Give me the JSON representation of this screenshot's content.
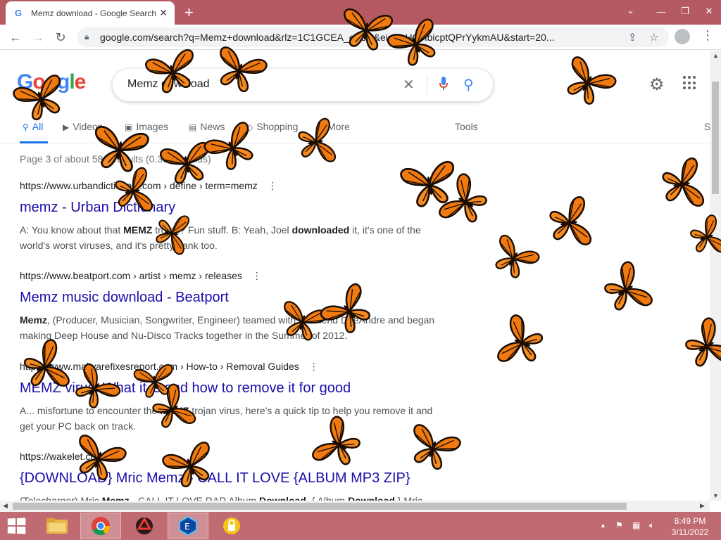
{
  "browser": {
    "tab_title": "Memz download - Google Search",
    "tab_favicon": "G",
    "url": "google.com/search?q=Memz+download&rlz=1C1GCEA_enUS&ei=YuHOHbicptQPrYykmAU&start=20..."
  },
  "search": {
    "logo": "Google",
    "query": "Memz download",
    "tabs": [
      {
        "label": "All",
        "icon": "search-icon"
      },
      {
        "label": "Videos",
        "icon": "video-icon"
      },
      {
        "label": "Images",
        "icon": "image-icon"
      },
      {
        "label": "News",
        "icon": "news-icon"
      },
      {
        "label": "Shopping",
        "icon": "tag-icon"
      },
      {
        "label": "More",
        "icon": "kebab-icon"
      },
      {
        "label": "Tools",
        "icon": ""
      },
      {
        "label": "S",
        "icon": ""
      }
    ],
    "stats": "Page 3 of about 58... results (0.39 seconds)"
  },
  "results": [
    {
      "cite": "https://www.urbandictionary.com › define › term=memz",
      "title": "memz - Urban Dictionary",
      "snippet_html": "A: You know about that <b>MEMZ</b> trojan? Fun stuff. B: Yeah, Joel <b>downloaded</b> it, it's one of the world's worst viruses, and it's pretty dank too."
    },
    {
      "cite": "https://www.beatport.com › artist › memz › releases",
      "title": "Memz music download - Beatport",
      "snippet_html": "<b>Memz</b>, (Producer, Musician, Songwriter, Engineer) teamed with DJ friend DeeAndre and began making Deep House and Nu-Disco Tracks together in the Summer of 2012."
    },
    {
      "cite": "https://www.malwarefixesreport.com › How-to › Removal Guides",
      "title": "MEMZ virus: What it is and how to remove it for good",
      "snippet_html": "A... misfortune to encounter the <b>MEMZ</b> trojan virus, here's a quick tip to help you remove it and get your PC back on track."
    },
    {
      "cite": "https://wakelet.com",
      "title": "{DOWNLOAD} Mric Memz - CALL IT LOVE {ALBUM MP3 ZIP}",
      "snippet_html": "(Telecharger) Mric <b>Memz</b> - CALL IT LOVE RAR Album <b>Download</b>, { Album <b>Download</b> } Mric <b>Memz</b>"
    }
  ],
  "taskbar": {
    "time": "8:49 PM",
    "date": "3/11/2022",
    "apps": [
      "file-explorer",
      "chrome",
      "memz-app",
      "vpn-app",
      "lock-app"
    ]
  },
  "colors": {
    "titlebar": "#b55a62",
    "taskbar": "#c06a71",
    "link": "#1a0dab",
    "accent": "#1a73e8",
    "butterfly_orange": "#f07a10"
  }
}
